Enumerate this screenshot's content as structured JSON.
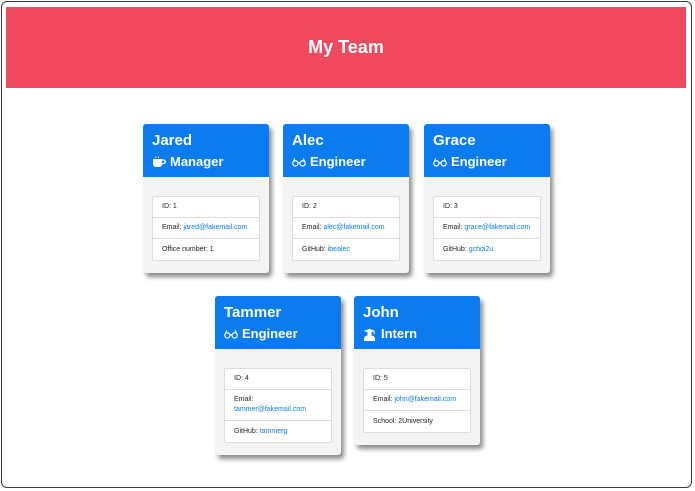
{
  "header": {
    "title": "My Team"
  },
  "colors": {
    "header_bg": "#f0495f",
    "card_head_bg": "#0b7cf0",
    "link": "#0b7cf0"
  },
  "employees": [
    {
      "name": "Jared",
      "role": "Manager",
      "role_icon": "mug-icon",
      "id_label": "ID: 1",
      "email_label": "Email:",
      "email": "jared@fakemail.com",
      "extra_label": "Office number: 1",
      "extra_value": ""
    },
    {
      "name": "Alec",
      "role": "Engineer",
      "role_icon": "glasses-icon",
      "id_label": "ID: 2",
      "email_label": "Email:",
      "email": "alec@fakemail.com",
      "extra_label": "GitHub:",
      "extra_value": "ibealec"
    },
    {
      "name": "Grace",
      "role": "Engineer",
      "role_icon": "glasses-icon",
      "id_label": "ID: 3",
      "email_label": "Email:",
      "email": "grace@fakemail.com",
      "extra_label": "GitHub:",
      "extra_value": "gchoi2u"
    },
    {
      "name": "Tammer",
      "role": "Engineer",
      "role_icon": "glasses-icon",
      "id_label": "ID: 4",
      "email_label": "Email:",
      "email": "tammer@fakemail.com",
      "extra_label": "GitHub:",
      "extra_value": "tammerg"
    },
    {
      "name": "John",
      "role": "Intern",
      "role_icon": "graduate-icon",
      "id_label": "ID: 5",
      "email_label": "Email:",
      "email": "john@fakemail.com",
      "extra_label": "School: 2University",
      "extra_value": ""
    }
  ]
}
